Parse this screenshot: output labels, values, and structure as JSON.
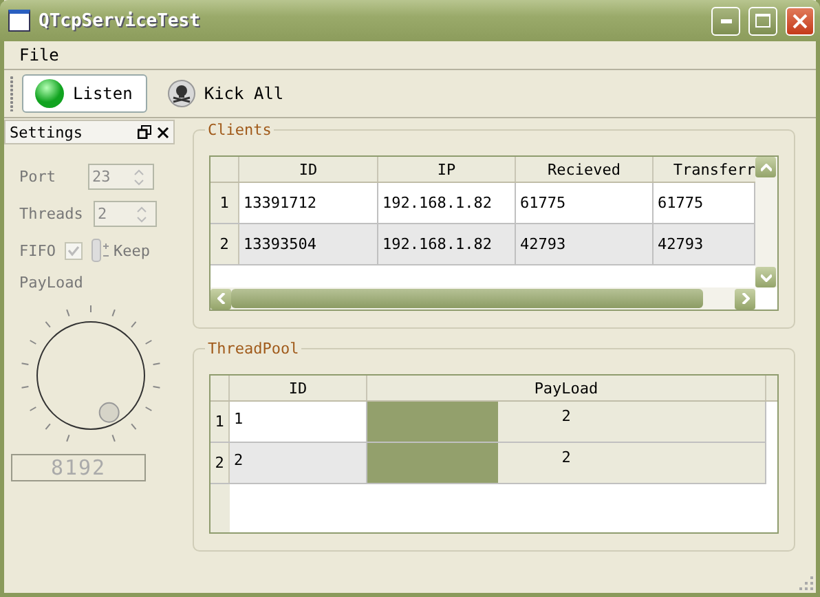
{
  "window": {
    "title": "QTcpServiceTest"
  },
  "menu": [
    "File"
  ],
  "toolbar": [
    {
      "kind": "listen",
      "label": "Listen"
    },
    {
      "kind": "kick",
      "label": "Kick All"
    }
  ],
  "settings": {
    "title": "Settings",
    "port": {
      "label": "Port",
      "value": "23",
      "disabled": true
    },
    "threads": {
      "label": "Threads",
      "value": "2",
      "disabled": true
    },
    "fifo": {
      "label": "FIFO",
      "checked": true,
      "disabled": true
    },
    "keep": {
      "label": "Keep"
    },
    "payload": {
      "label": "PayLoad",
      "display": "8192"
    }
  },
  "clients": {
    "title": "Clients",
    "columns": [
      "ID",
      "IP",
      "Recieved",
      "Transferr"
    ],
    "rows": [
      {
        "header": "1",
        "cells": [
          "13391712",
          "192.168.1.82",
          "61775",
          "61775"
        ]
      },
      {
        "header": "2",
        "cells": [
          "13393504",
          "192.168.1.82",
          "42793",
          "42793"
        ]
      }
    ]
  },
  "threadpool": {
    "title": "ThreadPool",
    "columns": [
      "ID",
      "PayLoad"
    ],
    "rows": [
      {
        "header": "1",
        "id": "1",
        "level": 0.33,
        "payload": "2"
      },
      {
        "header": "2",
        "id": "2",
        "level": 0.33,
        "payload": "2"
      }
    ]
  }
}
